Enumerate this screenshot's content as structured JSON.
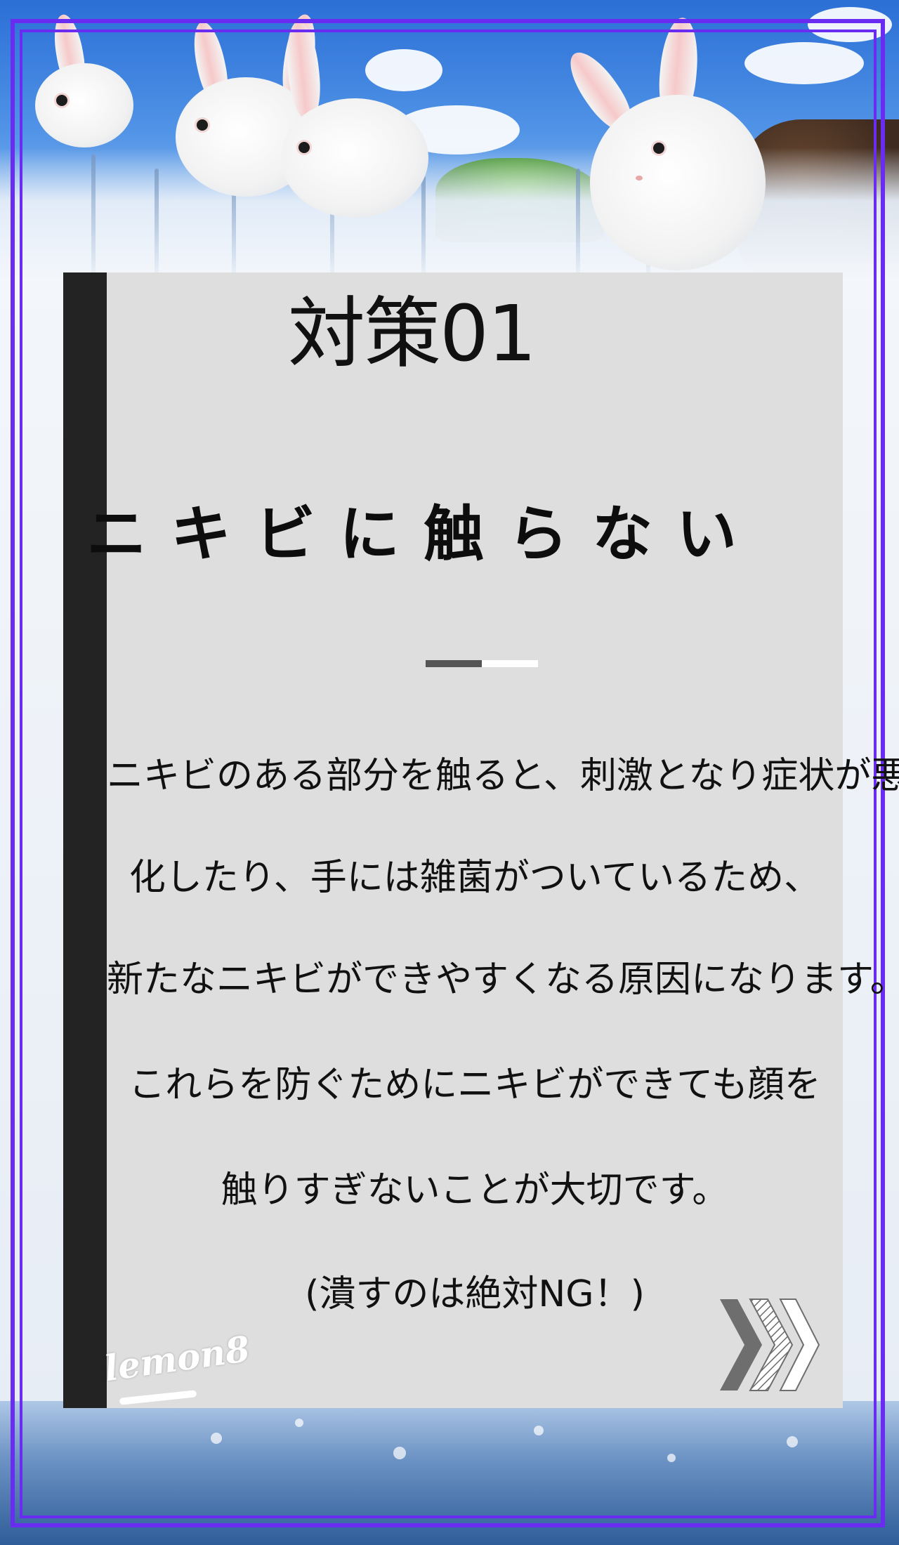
{
  "card": {
    "label": "対策01",
    "title": "ニキビに触らない",
    "body_lines": [
      "ニキビのある部分を触ると、刺激となり症状が悪",
      "化したり、手には雑菌がついているため、",
      "新たなニキビができやすくなる原因になります。",
      "これらを防ぐためにニキビができても顔を",
      "触りすぎないことが大切です。",
      "(潰すのは絶対NG！)"
    ]
  },
  "brand": {
    "watermark": "lemon8"
  },
  "icons": {
    "next": "chevrons-right-icon"
  },
  "colors": {
    "frame": "#6a2cf0",
    "card_background": "#dedede",
    "card_bar": "#232323",
    "divider_dark": "#555555",
    "divider_light": "#ffffff"
  }
}
